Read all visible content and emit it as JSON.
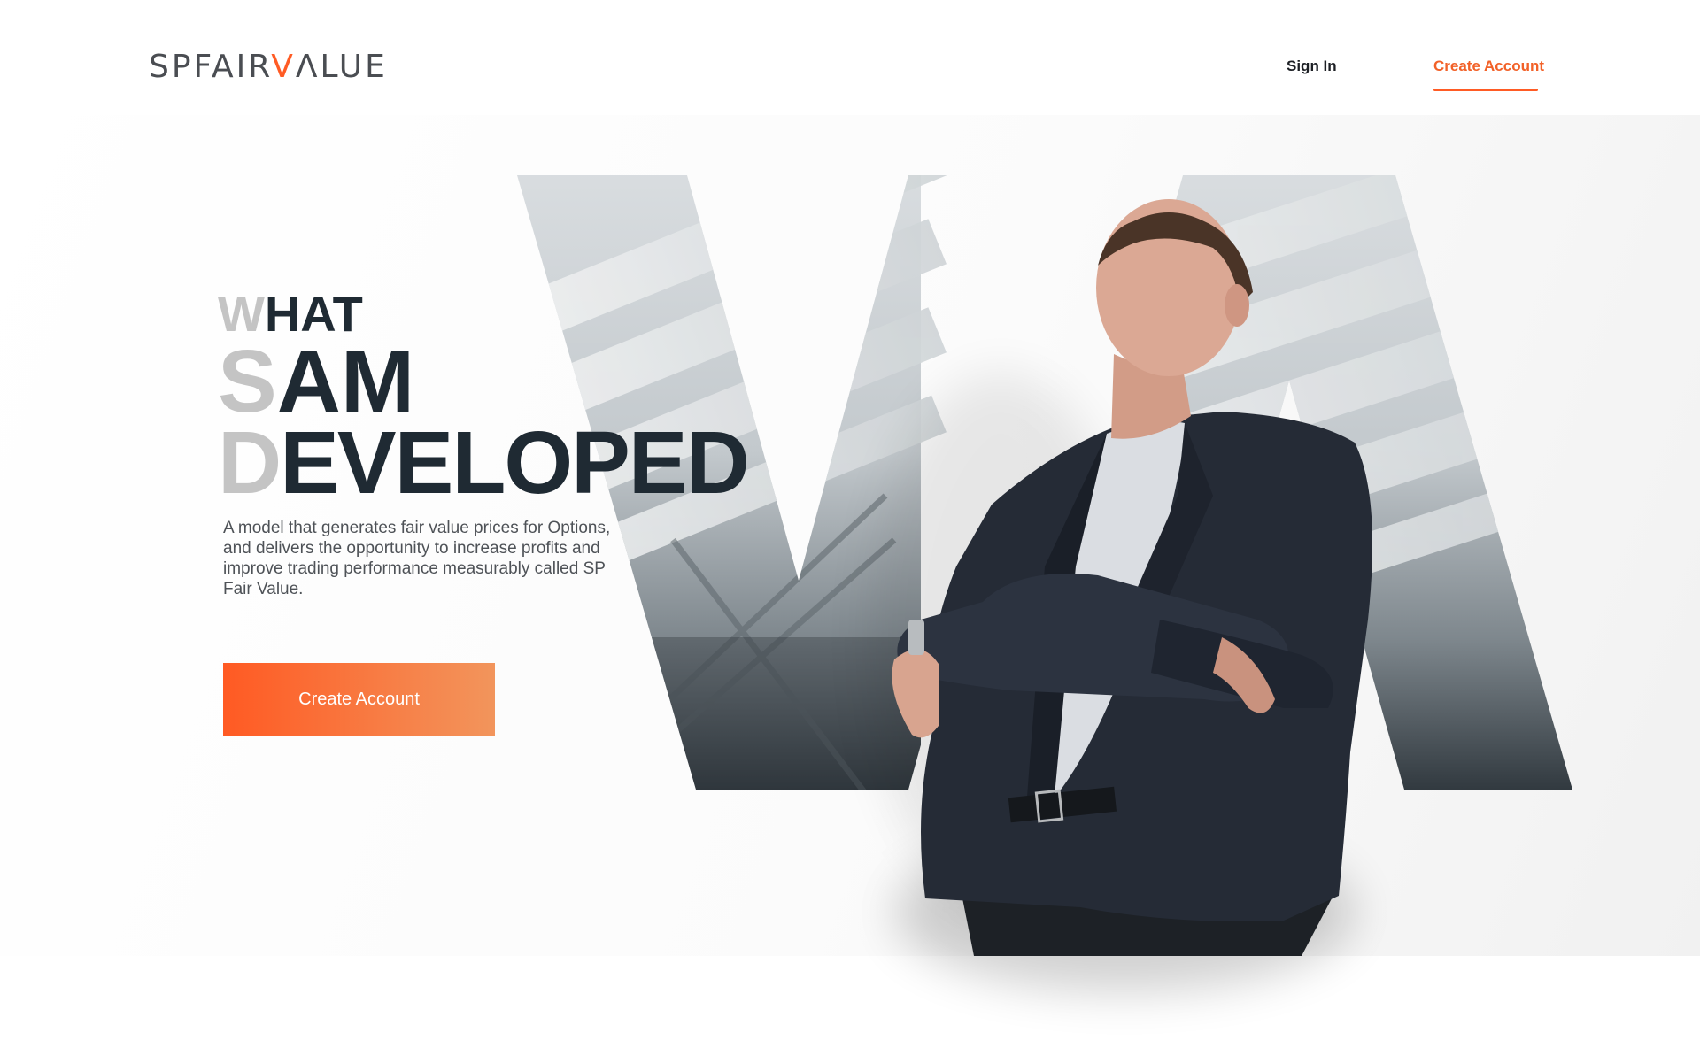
{
  "header": {
    "logo": {
      "part1": "SPFAIR",
      "accent": "V",
      "part2": "ΛLUE"
    },
    "nav": {
      "sign_in": "Sign In",
      "create_account": "Create Account"
    }
  },
  "hero": {
    "headline": [
      {
        "first": "W",
        "rest": "HAT"
      },
      {
        "first": "S",
        "rest": "AM"
      },
      {
        "first": "D",
        "rest": "EVELOPED"
      }
    ],
    "description": "A model that generates fair value prices for Options, and delivers the opportunity to increase profits and improve trading performance measurably called SP Fair Value.",
    "cta_label": "Create Account"
  },
  "colors": {
    "accent": "#ff5b24",
    "heading": "#1f2a33",
    "heading_muted": "#c4c4c4",
    "body_text": "#4e5257"
  },
  "icons": {
    "logo": "logo-wordmark",
    "hero_image": "businessman-photo"
  }
}
